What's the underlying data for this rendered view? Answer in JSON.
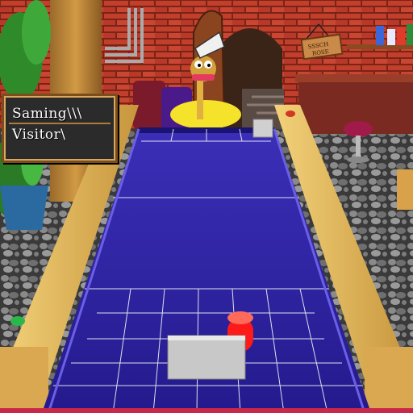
{
  "scoreboard": {
    "player_name": "Saming\\\\\\",
    "opponent_name": "Visitor\\"
  },
  "sign": {
    "line1": "SSSCH",
    "line2": "ROSE"
  },
  "colors": {
    "table_surface": "#2a1f9e",
    "table_rail": "#e0b85a",
    "puck": "#ff1a1a",
    "paddle": "#c8c8c8",
    "brick_wall": "#b8382a"
  }
}
